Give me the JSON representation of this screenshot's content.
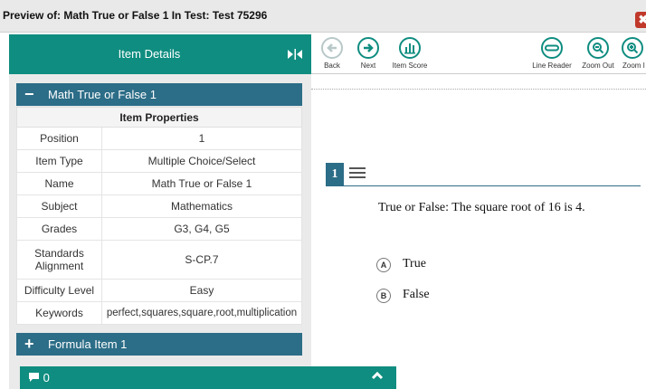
{
  "window": {
    "title": "Preview of: Math True or False 1 In Test: Test 75296",
    "close": "✖"
  },
  "left_panel": {
    "header": "Item Details",
    "collapse_icon": "▶|◀",
    "item_section": {
      "sign": "−",
      "title": "Math True or False 1"
    },
    "properties_header": "Item Properties",
    "properties": [
      {
        "key": "Position",
        "value": "1"
      },
      {
        "key": "Item Type",
        "value": "Multiple Choice/Select"
      },
      {
        "key": "Name",
        "value": "Math True or False 1"
      },
      {
        "key": "Subject",
        "value": "Mathematics"
      },
      {
        "key": "Grades",
        "value": "G3, G4, G5"
      },
      {
        "key": "Standards Alignment",
        "value": "S-CP.7"
      },
      {
        "key": "Difficulty Level",
        "value": "Easy"
      },
      {
        "key": "Keywords",
        "value": "perfect,squares,square,root,multiplication"
      }
    ],
    "formula_section": {
      "sign": "+",
      "title": "Formula Item 1"
    }
  },
  "footer": {
    "comment_count": "0",
    "comment_icon": "❞",
    "chevron": "Ɐ"
  },
  "toolbar": {
    "back": {
      "label": "Back",
      "glyph": "←"
    },
    "next": {
      "label": "Next",
      "glyph": "→"
    },
    "item_score": {
      "label": "Item Score",
      "glyph": "▐▌"
    },
    "line_reader": {
      "label": "Line Reader",
      "glyph": "▭"
    },
    "zoom_out": {
      "label": "Zoom Out",
      "glyph": "−"
    },
    "zoom_in": {
      "label": "Zoom I",
      "glyph": "+"
    }
  },
  "question": {
    "number": "1",
    "text": "True or False: The square root of 16 is 4.",
    "options": [
      {
        "letter": "A",
        "text": "True"
      },
      {
        "letter": "B",
        "text": "False"
      }
    ]
  },
  "colors": {
    "teal": "#0f8d80",
    "section_blue": "#2c6d87",
    "close_red": "#c0392b"
  }
}
